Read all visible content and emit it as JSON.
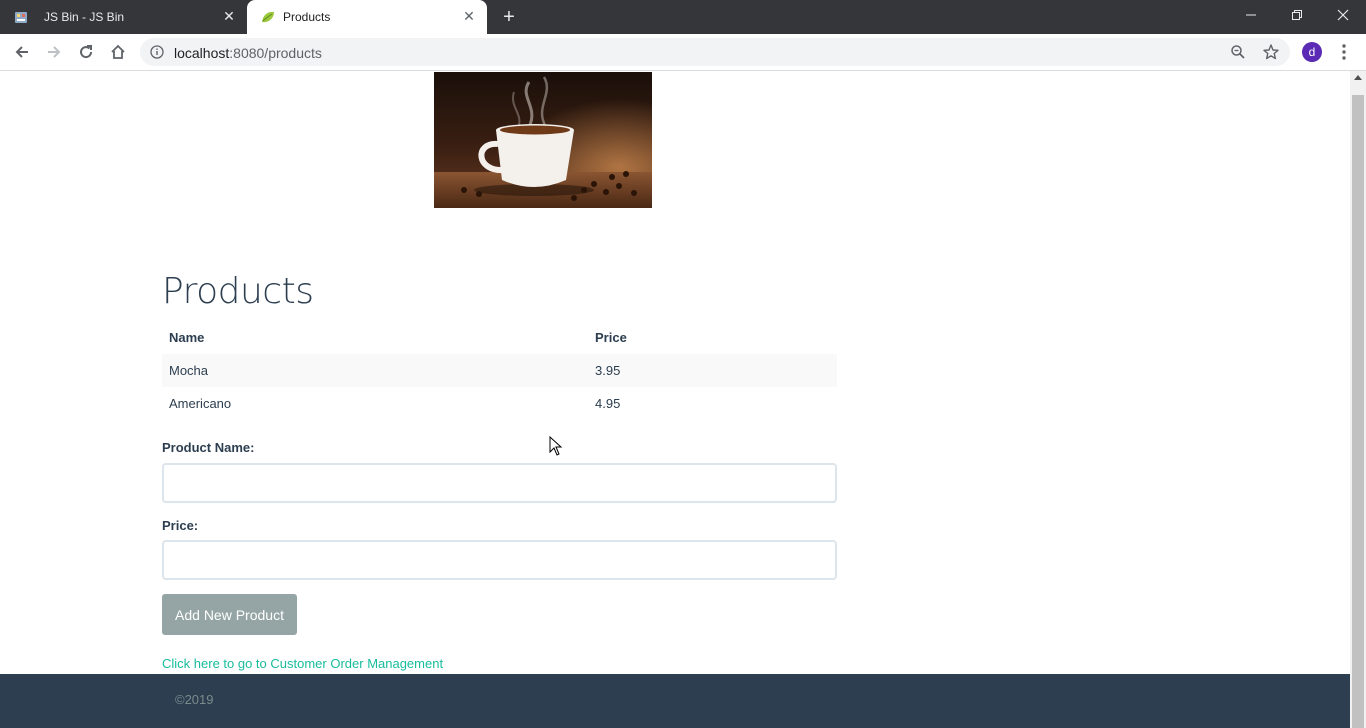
{
  "browser": {
    "tabs": [
      {
        "title": "JS Bin - JS Bin",
        "active": false
      },
      {
        "title": "Products",
        "active": true
      }
    ],
    "url_host": "localhost",
    "url_rest": ":8080/products",
    "profile_initial": "d"
  },
  "icons": {
    "tab1_favicon": "jsbin-icon",
    "tab2_favicon": "spring-leaf-icon",
    "close": "close-icon",
    "newtab": "plus-icon",
    "back": "back-arrow-icon",
    "forward": "forward-arrow-icon",
    "reload": "reload-icon",
    "home": "home-icon",
    "info": "info-icon",
    "zoom": "zoom-icon",
    "star": "star-icon",
    "menu": "menu-dots-icon"
  },
  "page": {
    "heading": "Products",
    "table": {
      "headers": [
        "Name",
        "Price"
      ],
      "rows": [
        [
          "Mocha",
          "3.95"
        ],
        [
          "Americano",
          "4.95"
        ]
      ]
    },
    "form": {
      "product_name_label": "Product Name:",
      "price_label": "Price:",
      "submit_label": "Add New Product"
    },
    "link_text": "Click here to go to Customer Order Management",
    "footer_text": "©2019"
  },
  "colors": {
    "primary_text": "#2c3e50",
    "link": "#18bc9c",
    "button": "#95a5a6",
    "footer_bg": "#2c3e50",
    "avatar": "#5b2bb5"
  }
}
